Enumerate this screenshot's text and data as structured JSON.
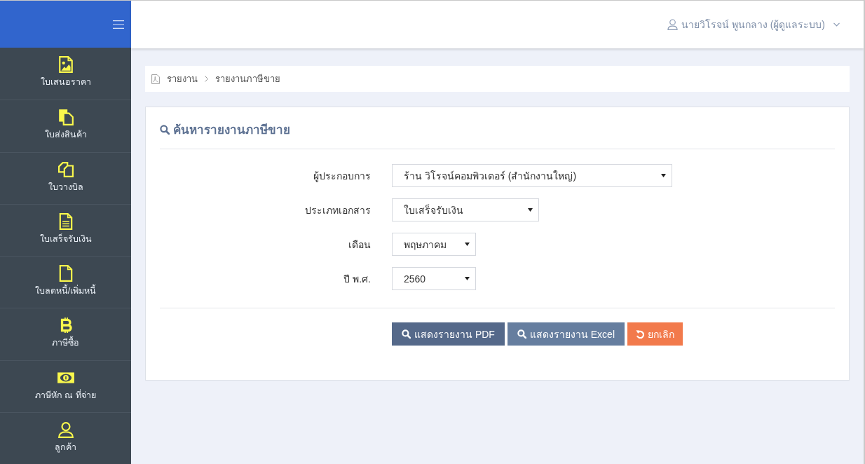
{
  "sidebar": {
    "items": [
      {
        "label": "ใบเสนอราคา"
      },
      {
        "label": "ใบส่งสินค้า"
      },
      {
        "label": "ใบวางบิล"
      },
      {
        "label": "ใบเสร็จรับเงิน"
      },
      {
        "label": "ใบลดหนี้/เพิ่มหนี้"
      },
      {
        "label": "ภาษีซื้อ"
      },
      {
        "label": "ภาษีหัก ณ ที่จ่าย"
      },
      {
        "label": "ลูกค้า"
      }
    ]
  },
  "header": {
    "user": "นายวิโรจน์ พูนกลาง (ผู้ดูแลระบบ)"
  },
  "breadcrumb": [
    {
      "label": "รายงาน"
    },
    {
      "label": "รายงานภาษีขาย"
    }
  ],
  "panel": {
    "title": "ค้นหารายงานภาษีขาย",
    "fields": [
      {
        "label": "ผู้ประกอบการ",
        "value": "ร้าน วิโรจน์คอมพิวเตอร์ (สำนักงานใหญ่)"
      },
      {
        "label": "ประเภทเอกสาร",
        "value": "ใบเสร็จรับเงิน"
      },
      {
        "label": "เดือน",
        "value": "พฤษภาคม"
      },
      {
        "label": "ปี พ.ศ.",
        "value": "2560"
      }
    ],
    "buttons": [
      {
        "label": "แสดงรายงาน PDF",
        "kind": "pdf"
      },
      {
        "label": "แสดงรายงาน Excel",
        "kind": "excel"
      },
      {
        "label": "ยกเลิก",
        "kind": "cancel"
      }
    ]
  }
}
